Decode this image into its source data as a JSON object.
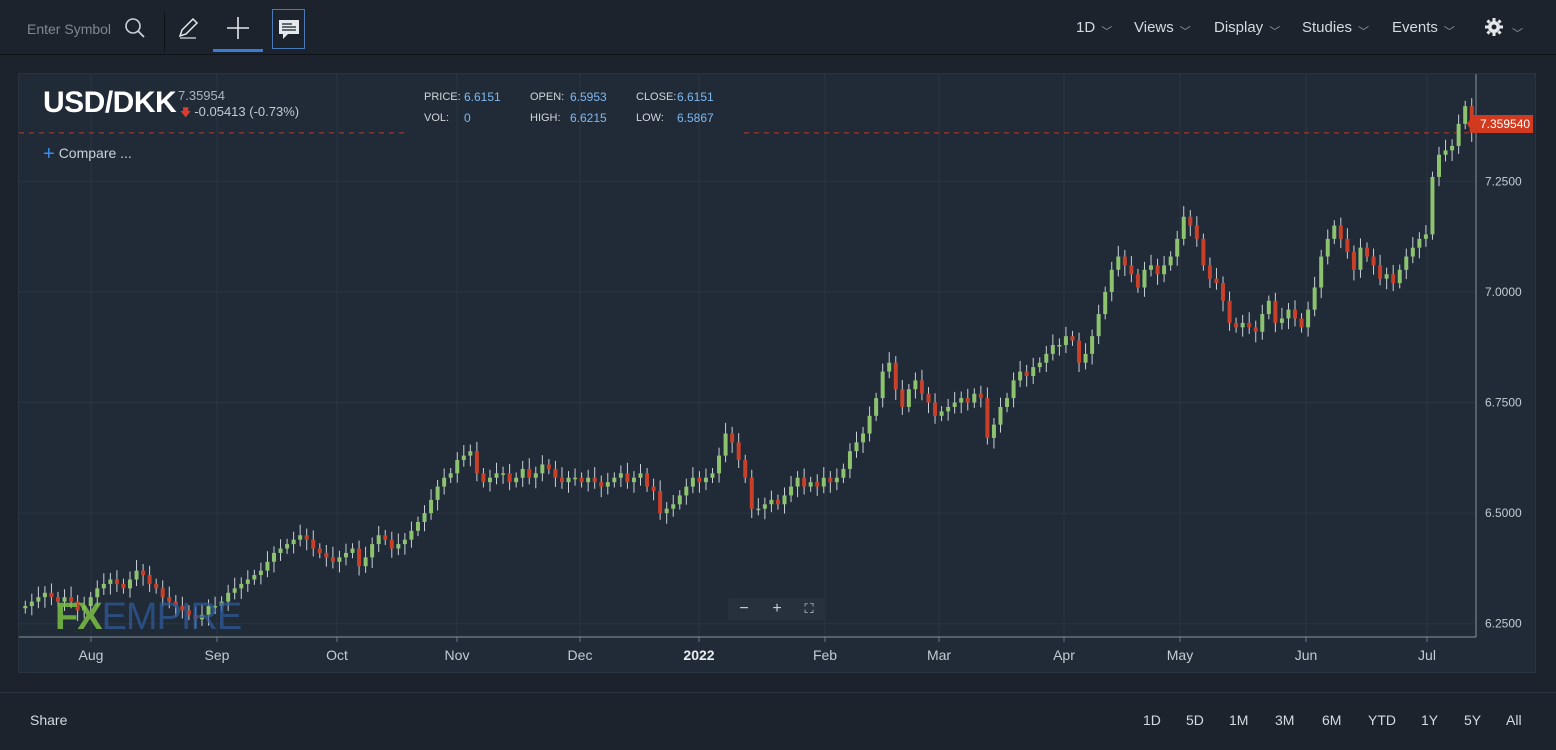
{
  "toolbar": {
    "search_placeholder": "Enter Symbol",
    "menus": [
      "1D",
      "Views",
      "Display",
      "Studies",
      "Events"
    ],
    "icons": [
      "search-icon",
      "pencil-icon",
      "crosshair-icon",
      "news-icon",
      "gear-icon"
    ]
  },
  "header": {
    "symbol": "USD/DKK",
    "last": "7.35954",
    "change": "-0.05413 (-0.73%)",
    "change_direction": "down",
    "ohlc": {
      "price_label": "PRICE:",
      "price": "6.6151",
      "open_label": "OPEN:",
      "open": "6.5953",
      "close_label": "CLOSE:",
      "close": "6.6151",
      "vol_label": "VOL:",
      "vol": "0",
      "high_label": "HIGH:",
      "high": "6.6215",
      "low_label": "LOW:",
      "low": "6.5867"
    },
    "compare_label": "Compare ..."
  },
  "price_tag": "7.359540",
  "zoom": {
    "minus": "−",
    "plus": "+",
    "fullscreen": "⛶"
  },
  "watermark": {
    "fx": "FX",
    "empire": "EMPIRE"
  },
  "bottom": {
    "share_label": "Share",
    "ranges": [
      "1D",
      "5D",
      "1M",
      "3M",
      "6M",
      "YTD",
      "1Y",
      "5Y",
      "All"
    ]
  },
  "colors": {
    "up": "#8dc26f",
    "down": "#c8402a",
    "background": "#202b37",
    "accent": "#3a8ef0"
  },
  "chart_data": {
    "type": "candlestick",
    "x_ticks": [
      "Aug",
      "Sep",
      "Oct",
      "Nov",
      "Dec",
      "2022",
      "Feb",
      "Mar",
      "Apr",
      "May",
      "Jun",
      "Jul"
    ],
    "y_ticks": [
      "6.2500",
      "6.5000",
      "6.7500",
      "7.0000",
      "7.2500"
    ],
    "ylim": [
      6.22,
      7.47
    ],
    "last_price_line": 7.35954,
    "closes": [
      6.29,
      6.3,
      6.31,
      6.32,
      6.31,
      6.3,
      6.31,
      6.3,
      6.28,
      6.29,
      6.31,
      6.33,
      6.34,
      6.35,
      6.34,
      6.33,
      6.35,
      6.37,
      6.36,
      6.34,
      6.33,
      6.31,
      6.3,
      6.29,
      6.28,
      6.27,
      6.26,
      6.27,
      6.29,
      6.29,
      6.3,
      6.32,
      6.33,
      6.34,
      6.35,
      6.36,
      6.37,
      6.39,
      6.41,
      6.42,
      6.43,
      6.44,
      6.45,
      6.44,
      6.42,
      6.41,
      6.4,
      6.39,
      6.4,
      6.41,
      6.42,
      6.38,
      6.4,
      6.43,
      6.45,
      6.44,
      6.42,
      6.43,
      6.44,
      6.46,
      6.48,
      6.5,
      6.53,
      6.56,
      6.58,
      6.59,
      6.62,
      6.63,
      6.64,
      6.59,
      6.57,
      6.58,
      6.59,
      6.59,
      6.57,
      6.58,
      6.6,
      6.58,
      6.59,
      6.61,
      6.6,
      6.58,
      6.57,
      6.58,
      6.58,
      6.57,
      6.58,
      6.57,
      6.56,
      6.57,
      6.58,
      6.59,
      6.57,
      6.58,
      6.59,
      6.56,
      6.55,
      6.5,
      6.51,
      6.52,
      6.54,
      6.56,
      6.58,
      6.57,
      6.58,
      6.59,
      6.63,
      6.68,
      6.66,
      6.62,
      6.58,
      6.51,
      6.51,
      6.52,
      6.53,
      6.52,
      6.54,
      6.56,
      6.58,
      6.56,
      6.57,
      6.56,
      6.58,
      6.57,
      6.58,
      6.6,
      6.64,
      6.66,
      6.68,
      6.72,
      6.76,
      6.82,
      6.84,
      6.78,
      6.74,
      6.78,
      6.8,
      6.77,
      6.75,
      6.72,
      6.73,
      6.74,
      6.75,
      6.76,
      6.75,
      6.77,
      6.76,
      6.67,
      6.7,
      6.74,
      6.76,
      6.8,
      6.82,
      6.81,
      6.83,
      6.84,
      6.86,
      6.88,
      6.88,
      6.9,
      6.89,
      6.84,
      6.86,
      6.9,
      6.95,
      7.0,
      7.05,
      7.08,
      7.06,
      7.04,
      7.01,
      7.05,
      7.06,
      7.04,
      7.06,
      7.08,
      7.12,
      7.17,
      7.15,
      7.12,
      7.06,
      7.03,
      7.02,
      6.98,
      6.93,
      6.92,
      6.93,
      6.92,
      6.91,
      6.95,
      6.98,
      6.93,
      6.94,
      6.96,
      6.94,
      6.92,
      6.96,
      7.01,
      7.08,
      7.12,
      7.15,
      7.12,
      7.09,
      7.05,
      7.1,
      7.08,
      7.06,
      7.03,
      7.04,
      7.02,
      7.05,
      7.08,
      7.1,
      7.12,
      7.13,
      7.26,
      7.31,
      7.32,
      7.33,
      7.38,
      7.42,
      7.36
    ]
  }
}
